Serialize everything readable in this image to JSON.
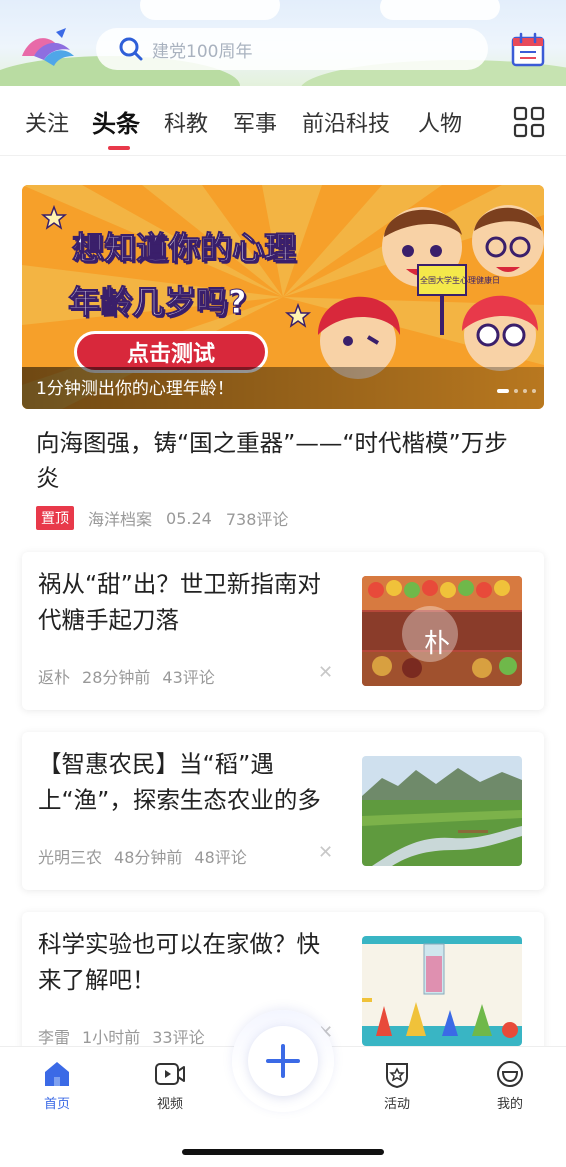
{
  "search": {
    "placeholder": "建党100周年"
  },
  "tabs": [
    "关注",
    "头条",
    "科教",
    "军事",
    "前沿科技",
    "人物"
  ],
  "active_tab": "头条",
  "banner": {
    "line1": "想知道你的心理",
    "line2": "年龄几岁吗?",
    "cta": "点击测试",
    "caption": "1分钟测出你的心理年龄！",
    "sign": "全国大学生心理健康日"
  },
  "headline": {
    "title": "向海图强，铸“国之重器”——“时代楷模”万步炎",
    "pin": "置顶",
    "source": "海洋档案",
    "date": "05.24",
    "comments": "738评论"
  },
  "cards": [
    {
      "title": "祸从“甜”出？世卫新指南对代糖手起刀落",
      "source": "返朴",
      "time": "28分钟前",
      "comments": "43评论",
      "thumb_text": "朴"
    },
    {
      "title": "【智惠农民】当“稻”遇上“渔”，探索生态农业的多",
      "source": "光明三农",
      "time": "48分钟前",
      "comments": "48评论"
    },
    {
      "title": "科学实验也可以在家做？快来了解吧！",
      "source": "李雷",
      "time": "1小时前",
      "comments": "33评论"
    }
  ],
  "nav": {
    "home": "首页",
    "video": "视频",
    "events": "活动",
    "me": "我的"
  },
  "colors": {
    "accent": "#e8394a",
    "primary": "#3b6ae6",
    "banner": "#f6a02a"
  },
  "icons": [
    "logo-icon",
    "search-icon",
    "calendar-icon",
    "grid-icon",
    "close-icon",
    "home-icon",
    "video-icon",
    "plus-icon",
    "events-icon",
    "me-icon"
  ]
}
